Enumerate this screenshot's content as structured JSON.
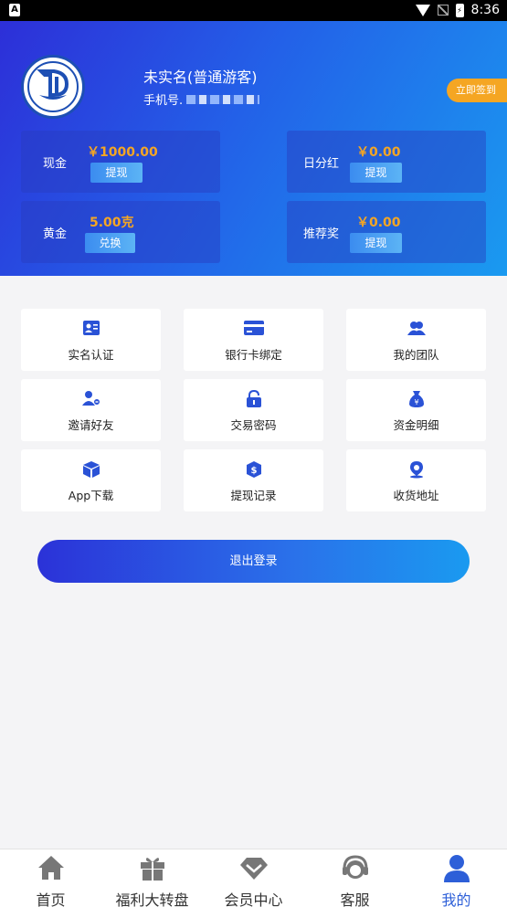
{
  "status_bar": {
    "left_badge": "A",
    "time": "8:36"
  },
  "profile": {
    "name": "未实名(普通游客)",
    "phone_label": "手机号.",
    "signin_button": "立即签到"
  },
  "cards": [
    {
      "label": "现金",
      "value": "￥1000.00",
      "button": "提现"
    },
    {
      "label": "日分红",
      "value": "￥0.00",
      "button": "提现"
    },
    {
      "label": "黄金",
      "value": "5.00克",
      "button": "兑换"
    },
    {
      "label": "推荐奖",
      "value": "￥0.00",
      "button": "提现"
    }
  ],
  "menu": [
    {
      "label": "实名认证",
      "icon": "id-card-icon"
    },
    {
      "label": "银行卡绑定",
      "icon": "bank-card-icon"
    },
    {
      "label": "我的团队",
      "icon": "team-icon"
    },
    {
      "label": "邀请好友",
      "icon": "invite-user-icon"
    },
    {
      "label": "交易密码",
      "icon": "lock-icon"
    },
    {
      "label": "资金明细",
      "icon": "money-bag-icon"
    },
    {
      "label": "App下载",
      "icon": "box-icon"
    },
    {
      "label": "提现记录",
      "icon": "withdraw-record-icon"
    },
    {
      "label": "收货地址",
      "icon": "location-icon"
    }
  ],
  "logout_button": "退出登录",
  "tabs": [
    {
      "label": "首页",
      "icon": "home-icon",
      "active": false
    },
    {
      "label": "福利大转盘",
      "icon": "gift-icon",
      "active": false
    },
    {
      "label": "会员中心",
      "icon": "diamond-icon",
      "active": false
    },
    {
      "label": "客服",
      "icon": "headset-icon",
      "active": false
    },
    {
      "label": "我的",
      "icon": "user-icon",
      "active": true
    }
  ],
  "colors": {
    "accent": "#2d5fd8",
    "gold": "#f5a623",
    "icon_blue": "#2a52d6"
  }
}
